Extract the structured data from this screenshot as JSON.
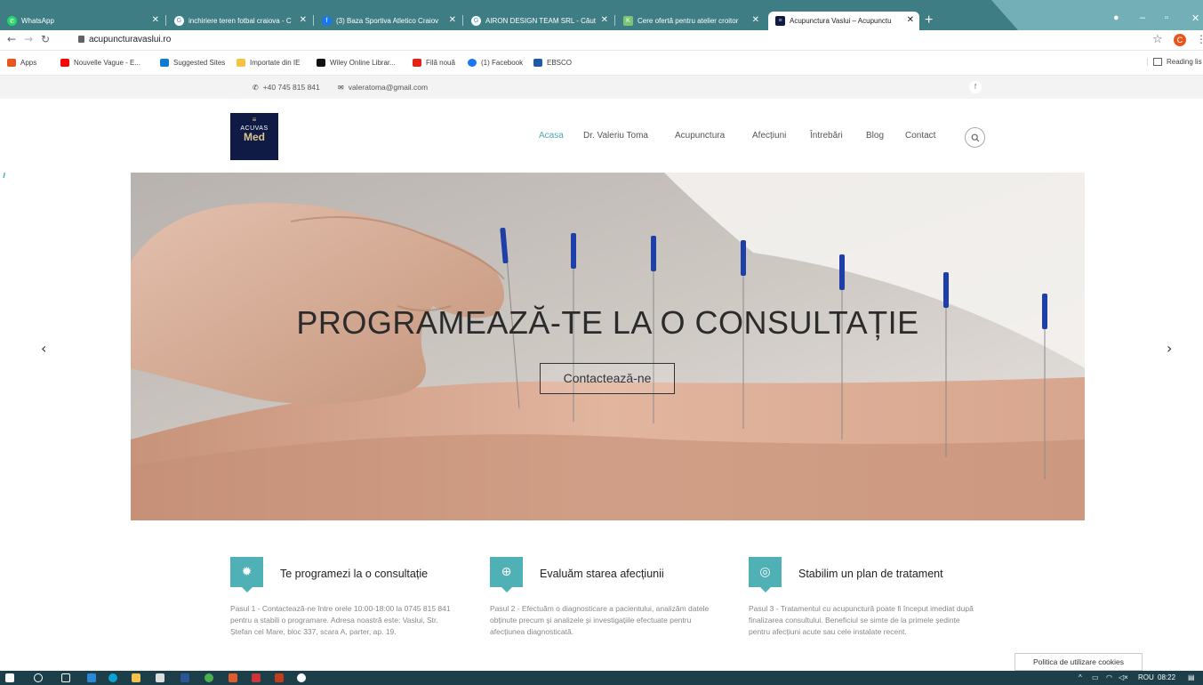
{
  "browser": {
    "tabs": [
      {
        "title": "WhatsApp",
        "icon": "whatsapp-icon",
        "color": "#25d366"
      },
      {
        "title": "inchiriere teren fotbal craiova - C",
        "icon": "google-icon",
        "color": "#ffffff"
      },
      {
        "title": "(3) Baza Sportiva Atletico Craiov",
        "icon": "facebook-icon",
        "color": "#1877f2"
      },
      {
        "title": "AIRON DESIGN TEAM SRL - Căut",
        "icon": "google-icon",
        "color": "#ffffff"
      },
      {
        "title": "Cere ofertă pentru atelier croitor",
        "icon": "site-icon",
        "color": "#7cc576"
      },
      {
        "title": "Acupunctura Vaslui – Acupunctu",
        "icon": "acuvas-icon",
        "color": "#0f1a45",
        "active": true
      }
    ],
    "url": "acupuncturavaslui.ro",
    "profile_initial": "C",
    "bookmarks": [
      {
        "label": "Apps",
        "icon": "apps-grid-icon",
        "color": "#e8561e"
      },
      {
        "label": "Nouvelle Vague - E...",
        "icon": "youtube-icon",
        "color": "#ff0000"
      },
      {
        "label": "Suggested Sites",
        "icon": "bing-icon",
        "color": "#0f7bd3"
      },
      {
        "label": "Importate din IE",
        "icon": "folder-icon",
        "color": "#f6c244"
      },
      {
        "label": "Wiley Online Librar...",
        "icon": "wiley-icon",
        "color": "#111111"
      },
      {
        "label": "Filă nouă",
        "icon": "news-icon",
        "color": "#e62117"
      },
      {
        "label": "(1) Facebook",
        "icon": "facebook-icon",
        "color": "#1877f2"
      },
      {
        "label": "EBSCO",
        "icon": "ebsco-icon",
        "color": "#1f5aa6"
      }
    ],
    "reading_list": "Reading lis"
  },
  "site": {
    "phone": "+40 745 815 841",
    "email": "valeratoma@gmail.com",
    "facebook": "f",
    "logo": {
      "lines": "≡",
      "top": "ACUVAS",
      "bottom": "Med"
    },
    "nav": [
      "Acasa",
      "Dr. Valeriu Toma",
      "Acupunctura",
      "Afecțiuni",
      "Întrebări",
      "Blog",
      "Contact"
    ],
    "hero": {
      "title": "PROGRAMEAZĂ-TE LA O CONSULTAȚIE",
      "button": "Contactează-ne",
      "prev": "‹",
      "next": "›"
    },
    "features": [
      {
        "title": "Te programezi la o consultație",
        "icon": "gear-icon",
        "text": "Pasul 1 - Contactează-ne între orele 10:00-18:00 la 0745 815 841 pentru a stabili o programare. Adresa noastră este: Vaslui, Str. Ștefan cel Mare, bloc 337, scara A, parter, ap. 19."
      },
      {
        "title": "Evaluăm starea afecțiunii",
        "icon": "lifebuoy-icon",
        "text": "Pasul 2 - Efectuăm o diagnosticare a pacientului, analizăm datele obținute precum și analizele și investigațiile efectuate pentru afecțiunea diagnosticată."
      },
      {
        "title": "Stabilim un plan de tratament",
        "icon": "chrome-icon",
        "text": "Pasul 3 - Tratamentul cu acupunctură poate fi început imediat după finalizarea consultului. Beneficiul se simte de la primele ședinte pentru afecțiuni acute sau cele instalate recent."
      }
    ],
    "cookie": "Politica de utilizare cookies",
    "accent_color": "#4fb0b5"
  },
  "taskbar": {
    "tray_lang": "ROU",
    "tray_time": "08:22"
  }
}
